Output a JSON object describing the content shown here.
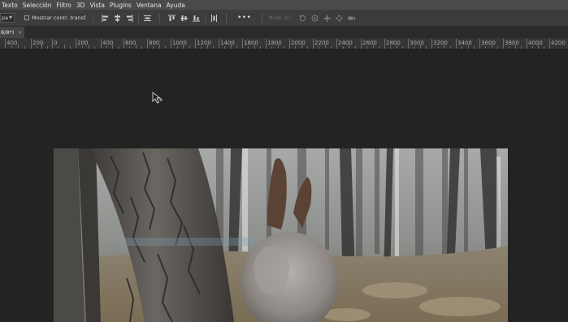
{
  "menu": [
    "Texto",
    "Selección",
    "Filtro",
    "3D",
    "Vista",
    "Plugins",
    "Ventana",
    "Ayuda"
  ],
  "options": {
    "preset_label": "pa",
    "show_transform_label": "Mostrar contr. transf.",
    "mode3d_label": "Modo 3D:",
    "more": "•••"
  },
  "tab": {
    "label": "8/8*)",
    "close": "×"
  },
  "ruler": {
    "labels": [
      "400",
      "200",
      "0",
      "200",
      "400",
      "600",
      "800",
      "1000",
      "1200",
      "1400",
      "1600",
      "1800",
      "2000",
      "2200",
      "2400",
      "2600",
      "2800",
      "3000",
      "3200",
      "3400",
      "3600",
      "3800",
      "4000",
      "4200"
    ]
  },
  "icons": {
    "align": [
      "align-left-icon",
      "align-center-h-icon",
      "align-right-icon",
      "distribute-h-icon",
      "align-top-icon",
      "align-center-v-icon",
      "align-bottom-icon",
      "distribute-v-icon"
    ],
    "three_d": [
      "orbit-3d-icon",
      "roll-3d-icon",
      "pan-3d-icon",
      "slide-3d-icon",
      "scale-3d-icon"
    ]
  }
}
